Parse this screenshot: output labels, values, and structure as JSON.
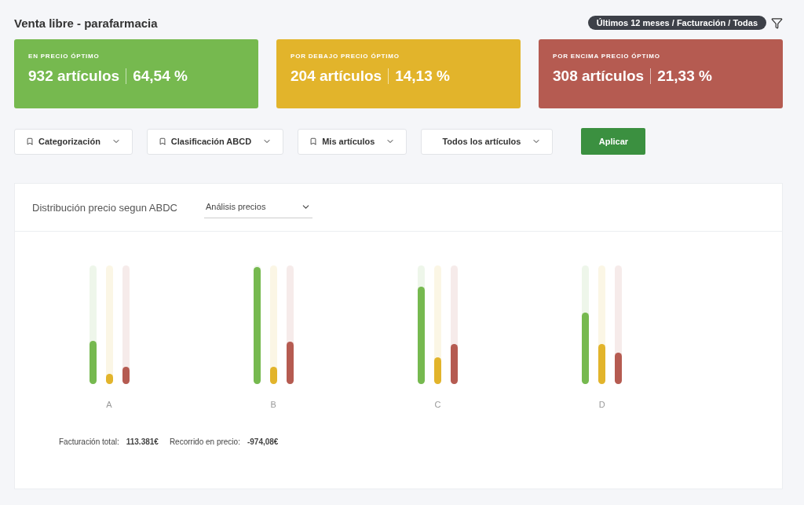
{
  "title": "Venta libre - parafarmacia",
  "filter_pill": "Últimos 12 meses / Facturación / Todas",
  "cards": [
    {
      "label": "EN PRECIO ÓPTIMO",
      "count": "932 artículos",
      "percent": "64,54 %",
      "color": "#76b94f"
    },
    {
      "label": "POR DEBAJO PRECIO ÓPTIMO",
      "count": "204 artículos",
      "percent": "14,13 %",
      "color": "#e2b42b"
    },
    {
      "label": "POR ENCIMA PRECIO ÓPTIMO",
      "count": "308 artículos",
      "percent": "21,33 %",
      "color": "#b55b51"
    }
  ],
  "filters": [
    {
      "label": "Categorización",
      "bookmark": true
    },
    {
      "label": "Clasificación ABCD",
      "bookmark": true
    },
    {
      "label": "Mis artículos",
      "bookmark": true
    },
    {
      "label": "Todos los artículos",
      "bookmark": false
    }
  ],
  "apply_button": "Aplicar",
  "panel": {
    "title": "Distribución precio segun ABDC",
    "select": "Análisis precios",
    "groups": [
      {
        "label": "A",
        "bars": [
          {
            "level": 0.37,
            "color": "#76b94f"
          },
          {
            "level": 0.09,
            "color": "#e2b42b"
          },
          {
            "level": 0.15,
            "color": "#b55b51"
          }
        ]
      },
      {
        "label": "B",
        "bars": [
          {
            "level": 1,
            "color": "#76b94f"
          },
          {
            "level": 0.15,
            "color": "#e2b42b"
          },
          {
            "level": 0.36,
            "color": "#b55b51"
          }
        ]
      },
      {
        "label": "C",
        "bars": [
          {
            "level": 0.83,
            "color": "#76b94f"
          },
          {
            "level": 0.23,
            "color": "#e2b42b"
          },
          {
            "level": 0.34,
            "color": "#b55b51"
          }
        ]
      },
      {
        "label": "D",
        "bars": [
          {
            "level": 0.61,
            "color": "#76b94f"
          },
          {
            "level": 0.34,
            "color": "#e2b42b"
          },
          {
            "level": 0.27,
            "color": "#b55b51"
          }
        ]
      }
    ],
    "totals": [
      {
        "label": "Facturación total:",
        "value": "113.381€"
      },
      {
        "label": "Recorrido en precio:",
        "value": "-974,08€"
      }
    ]
  }
}
